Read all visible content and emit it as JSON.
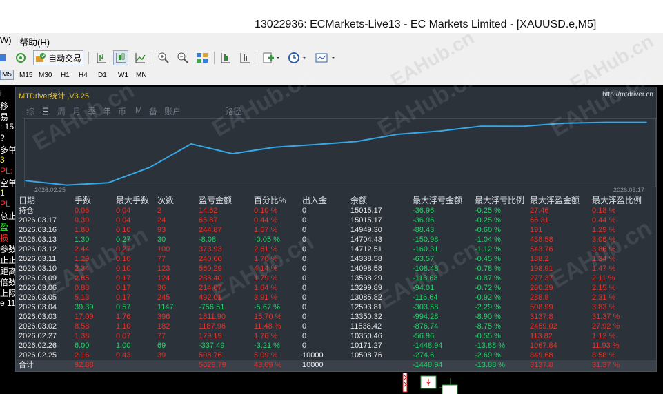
{
  "window": {
    "title": "13022936: ECMarkets-Live13 - EC Markets Limited - [XAUUSD.e,M5]"
  },
  "menu": {
    "items": [
      "W)",
      "帮助(H)"
    ]
  },
  "toolbar": {
    "auto_trade_label": "自动交易",
    "icons": [
      "chart-icon",
      "refresh-icon",
      "auto-trade-icon",
      "bar-chart-icon",
      "candle-chart-icon",
      "line-chart-icon",
      "zoom-in-icon",
      "zoom-out-icon",
      "tile-icon",
      "scroll-icon",
      "shift-icon",
      "indicator-icon",
      "period-icon",
      "template-icon"
    ]
  },
  "timeframes": [
    "M5",
    "M15",
    "M30",
    "H1",
    "H4",
    "D1",
    "W1",
    "MN"
  ],
  "active_timeframe": "M5",
  "left_panel_fragments": [
    {
      "text": "i",
      "color": "#ffffff"
    },
    {
      "text": "移",
      "color": "#ffffff"
    },
    {
      "text": "易",
      "color": "#ffffff"
    },
    {
      "text": ": 15",
      "color": "#ffffff"
    },
    {
      "text": "?",
      "color": "#ffffff"
    },
    {
      "text": "多单",
      "color": "#ffffff"
    },
    {
      "text": "3",
      "color": "#ffff00"
    },
    {
      "text": "PL:",
      "color": "#ff3030"
    },
    {
      "text": "空单",
      "color": "#ffffff"
    },
    {
      "text": "1",
      "color": "#ffff00"
    },
    {
      "text": "PL",
      "color": "#ff3030"
    },
    {
      "text": "总止盈",
      "color": "#ffffff"
    },
    {
      "text": "盈",
      "color": "#30ff30"
    },
    {
      "text": "损",
      "color": "#ff3030"
    },
    {
      "text": "参数",
      "color": "#ffffff"
    },
    {
      "text": "止止",
      "color": "#ffffff"
    },
    {
      "text": "距离",
      "color": "#ffffff"
    },
    {
      "text": "倍数",
      "color": "#ffffff"
    },
    {
      "text": "上限",
      "color": "#ffffff"
    },
    {
      "text": "e 11",
      "color": "#ffffff"
    }
  ],
  "dashboard": {
    "title": "MTDriver统计 ,V3.25",
    "url": "http://mtdriver.cn",
    "tabs": [
      "综",
      "日",
      "周",
      "月",
      "季",
      "年",
      "币",
      "M",
      "备",
      "账户",
      "路径"
    ],
    "active_tab": "日",
    "colors": {
      "line": "#35a9e8",
      "background": "#2b323a",
      "profit": "#28d06a",
      "loss": "#e0342c"
    },
    "chart_start_label": "2026.02.25",
    "chart_end_label": "2026.03.17",
    "headers": [
      "日期",
      "手数",
      "最大手数",
      "次数",
      "盈亏金额",
      "百分比%",
      "出入金",
      "余额",
      "最大浮亏金额",
      "最大浮亏比例",
      "最大浮盈金额",
      "最大浮盈比例"
    ],
    "rows": [
      {
        "date": "持仓",
        "lots": "0.06",
        "max_lots": "0.04",
        "count": "2",
        "pnl": "14.62",
        "pct": "0.10 %",
        "flow": "0",
        "balance": "15015.17",
        "max_dd": "-36.96",
        "max_dd_pct": "-0.25 %",
        "max_fp": "27.46",
        "max_fp_pct": "0.18 %",
        "c": "r"
      },
      {
        "date": "2026.03.17",
        "lots": "0.39",
        "max_lots": "0.04",
        "count": "24",
        "pnl": "65.87",
        "pct": "0.44 %",
        "flow": "0",
        "balance": "15015.17",
        "max_dd": "-36.96",
        "max_dd_pct": "-0.25 %",
        "max_fp": "66.31",
        "max_fp_pct": "0.44 %",
        "c": "r"
      },
      {
        "date": "2026.03.16",
        "lots": "1.80",
        "max_lots": "0.10",
        "count": "93",
        "pnl": "244.87",
        "pct": "1.67 %",
        "flow": "0",
        "balance": "14949.30",
        "max_dd": "-88.43",
        "max_dd_pct": "-0.60 %",
        "max_fp": "191",
        "max_fp_pct": "1.29 %",
        "c": "r"
      },
      {
        "date": "2026.03.13",
        "lots": "1.30",
        "max_lots": "0.27",
        "count": "30",
        "pnl": "-8.08",
        "pct": "-0.05 %",
        "flow": "0",
        "balance": "14704.43",
        "max_dd": "-150.98",
        "max_dd_pct": "-1.04 %",
        "max_fp": "438.58",
        "max_fp_pct": "3.06 %",
        "c": "g"
      },
      {
        "date": "2026.03.12",
        "lots": "2.44",
        "max_lots": "0.27",
        "count": "100",
        "pnl": "373.93",
        "pct": "2.61 %",
        "flow": "0",
        "balance": "14712.51",
        "max_dd": "-160.31",
        "max_dd_pct": "-1.12 %",
        "max_fp": "543.76",
        "max_fp_pct": "3.86 %",
        "c": "r"
      },
      {
        "date": "2026.03.11",
        "lots": "1.29",
        "max_lots": "0.10",
        "count": "77",
        "pnl": "240.00",
        "pct": "1.70 %",
        "flow": "0",
        "balance": "14338.58",
        "max_dd": "-63.57",
        "max_dd_pct": "-0.45 %",
        "max_fp": "188.2",
        "max_fp_pct": "1.34 %",
        "c": "r"
      },
      {
        "date": "2026.03.10",
        "lots": "2.34",
        "max_lots": "0.10",
        "count": "123",
        "pnl": "560.29",
        "pct": "4.14 %",
        "flow": "0",
        "balance": "14098.58",
        "max_dd": "-108.48",
        "max_dd_pct": "-0.78 %",
        "max_fp": "198.91",
        "max_fp_pct": "1.47 %",
        "c": "r"
      },
      {
        "date": "2026.03.09",
        "lots": "2.65",
        "max_lots": "0.17",
        "count": "124",
        "pnl": "238.40",
        "pct": "1.79 %",
        "flow": "0",
        "balance": "13538.29",
        "max_dd": "-113.63",
        "max_dd_pct": "-0.87 %",
        "max_fp": "277.37",
        "max_fp_pct": "2.11 %",
        "c": "r"
      },
      {
        "date": "2026.03.06",
        "lots": "0.88",
        "max_lots": "0.17",
        "count": "36",
        "pnl": "214.07",
        "pct": "1.64 %",
        "flow": "0",
        "balance": "13299.89",
        "max_dd": "-94.01",
        "max_dd_pct": "-0.72 %",
        "max_fp": "280.29",
        "max_fp_pct": "2.15 %",
        "c": "r"
      },
      {
        "date": "2026.03.05",
        "lots": "5.13",
        "max_lots": "0.17",
        "count": "245",
        "pnl": "492.01",
        "pct": "3.91 %",
        "flow": "0",
        "balance": "13085.82",
        "max_dd": "-116.64",
        "max_dd_pct": "-0.92 %",
        "max_fp": "288.8",
        "max_fp_pct": "2.31 %",
        "c": "r"
      },
      {
        "date": "2026.03.04",
        "lots": "39.39",
        "max_lots": "0.57",
        "count": "1147",
        "pnl": "-756.51",
        "pct": "-5.67 %",
        "flow": "0",
        "balance": "12593.81",
        "max_dd": "-303.58",
        "max_dd_pct": "-2.29 %",
        "max_fp": "508.99",
        "max_fp_pct": "3.83 %",
        "c": "g"
      },
      {
        "date": "2026.03.03",
        "lots": "17.09",
        "max_lots": "1.76",
        "count": "396",
        "pnl": "1811.90",
        "pct": "15.70 %",
        "flow": "0",
        "balance": "13350.32",
        "max_dd": "-994.28",
        "max_dd_pct": "-8.90 %",
        "max_fp": "3137.8",
        "max_fp_pct": "31.37 %",
        "c": "r"
      },
      {
        "date": "2026.03.02",
        "lots": "8.58",
        "max_lots": "1.10",
        "count": "182",
        "pnl": "1187.96",
        "pct": "11.48 %",
        "flow": "0",
        "balance": "11538.42",
        "max_dd": "-876.74",
        "max_dd_pct": "-8.75 %",
        "max_fp": "2459.02",
        "max_fp_pct": "27.92 %",
        "c": "r"
      },
      {
        "date": "2026.02.27",
        "lots": "1.38",
        "max_lots": "0.07",
        "count": "77",
        "pnl": "179.19",
        "pct": "1.76 %",
        "flow": "0",
        "balance": "10350.46",
        "max_dd": "-56.96",
        "max_dd_pct": "-0.55 %",
        "max_fp": "113.82",
        "max_fp_pct": "1.12 %",
        "c": "r"
      },
      {
        "date": "2026.02.26",
        "lots": "6.00",
        "max_lots": "1.00",
        "count": "69",
        "pnl": "-337.49",
        "pct": "-3.21 %",
        "flow": "0",
        "balance": "10171.27",
        "max_dd": "-1448.94",
        "max_dd_pct": "-13.88 %",
        "max_fp": "1067.84",
        "max_fp_pct": "11.93 %",
        "c": "g"
      },
      {
        "date": "2026.02.25",
        "lots": "2.16",
        "max_lots": "0.43",
        "count": "39",
        "pnl": "508.76",
        "pct": "5.09 %",
        "flow": "10000",
        "balance": "10508.76",
        "max_dd": "-274.6",
        "max_dd_pct": "-2.69 %",
        "max_fp": "849.68",
        "max_fp_pct": "8.58 %",
        "c": "r"
      }
    ],
    "total": {
      "date": "合计",
      "lots": "92.88",
      "max_lots": "",
      "count": "",
      "pnl": "5029.79",
      "pct": "43.09 %",
      "flow": "10000",
      "balance": "",
      "max_dd": "-1448.94",
      "max_dd_pct": "-13.88 %",
      "max_fp": "3137.8",
      "max_fp_pct": "31.37 %"
    }
  },
  "chart_data": {
    "type": "line",
    "x": [
      "2026.02.25",
      "2026.02.26",
      "2026.02.27",
      "2026.03.02",
      "2026.03.03",
      "2026.03.04",
      "2026.03.05",
      "2026.03.06",
      "2026.03.09",
      "2026.03.10",
      "2026.03.11",
      "2026.03.12",
      "2026.03.13",
      "2026.03.16",
      "2026.03.17",
      "持仓"
    ],
    "values": [
      10508.76,
      10171.27,
      10350.46,
      11538.42,
      13350.32,
      12593.81,
      13085.82,
      13299.89,
      13538.29,
      14098.58,
      14338.58,
      14712.51,
      14704.43,
      14949.3,
      15015.17,
      15015.17
    ],
    "grid": false
  },
  "watermark": "EAHub.cn"
}
